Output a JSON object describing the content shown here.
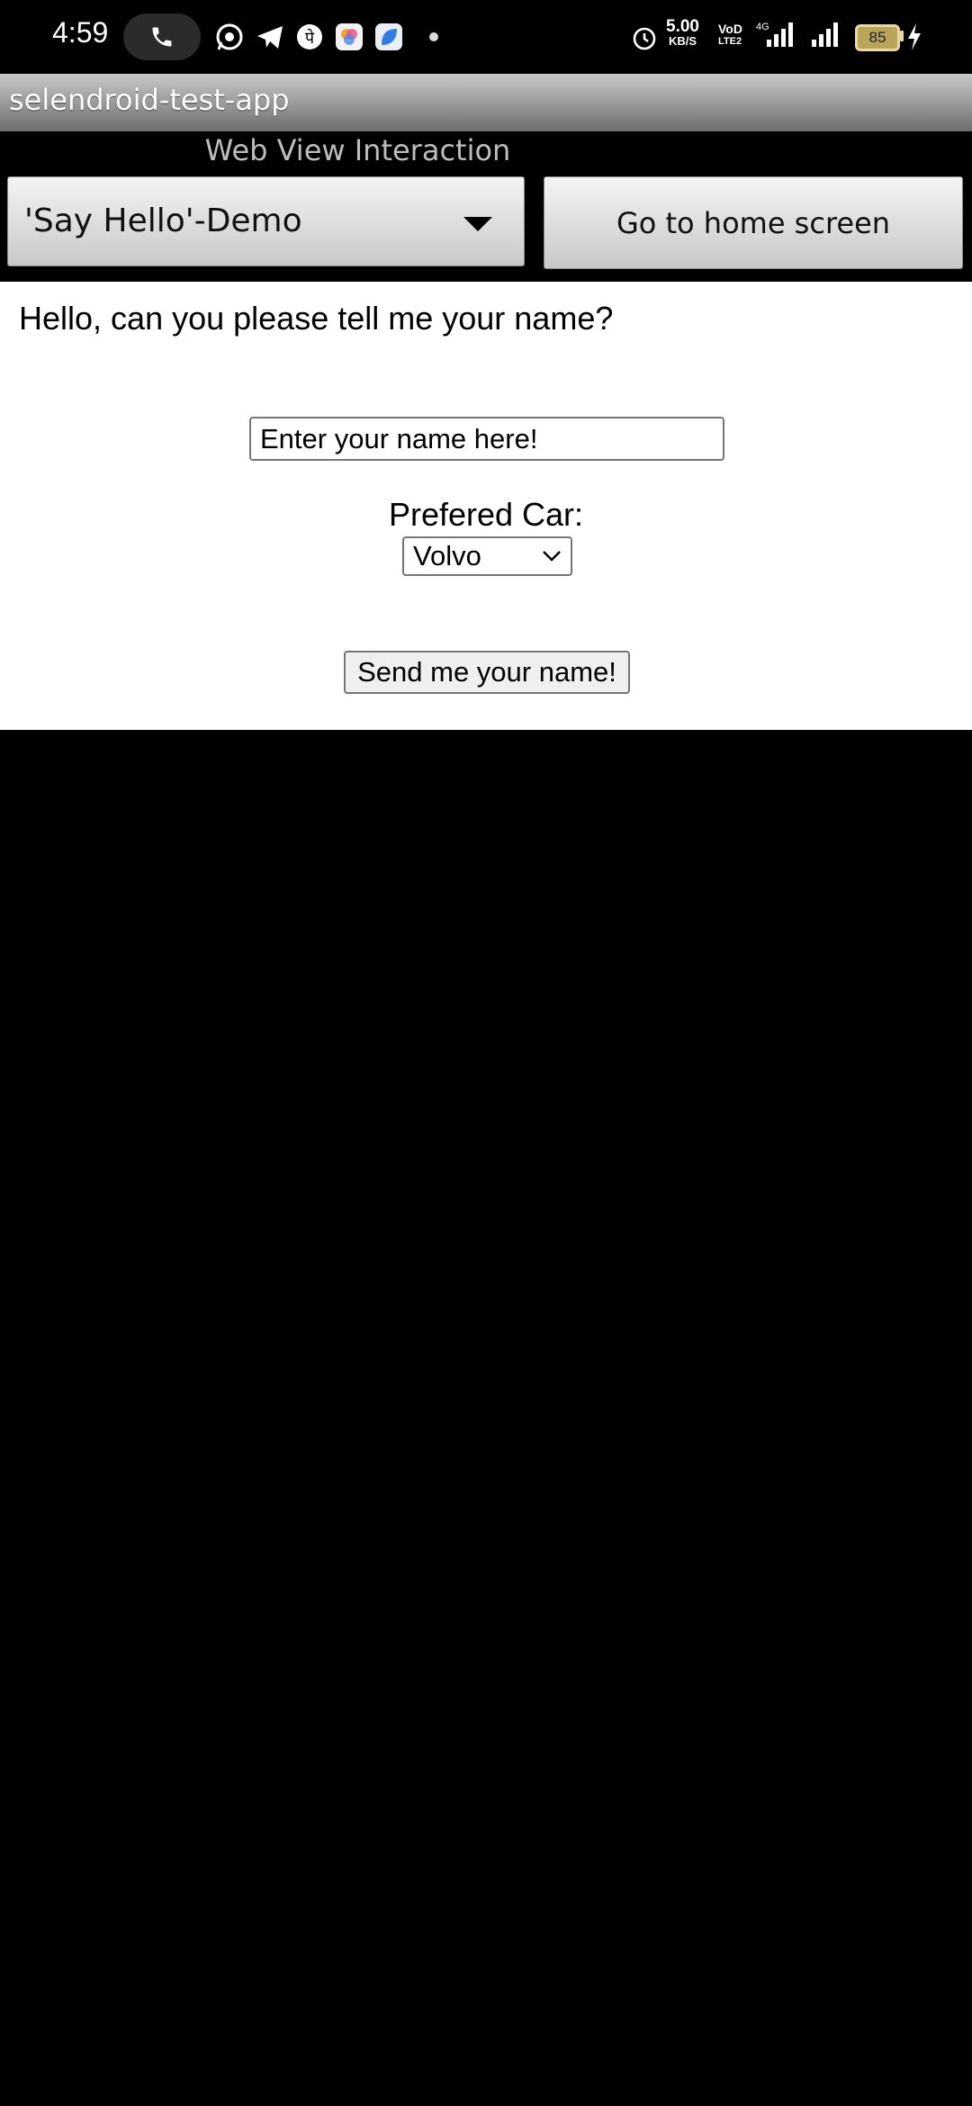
{
  "status_bar": {
    "time": "4:59",
    "net_speed_value": "5.00",
    "net_speed_unit": "KB/S",
    "volte_top": "VoD",
    "volte_bottom": "LTE2",
    "network_type": "4G",
    "battery_level": "85",
    "icons": [
      "phone-icon",
      "whatsapp-icon",
      "telegram-icon",
      "phonepe-icon",
      "photos-icon",
      "blue-app-icon",
      "alarm-icon",
      "signal-icon",
      "charging-icon"
    ]
  },
  "app_bar": {
    "title": "selendroid-test-app"
  },
  "header": {
    "section_label": "Web View Interaction",
    "spinner_value": "'Say Hello'-Demo",
    "home_button_label": "Go to home screen"
  },
  "webview": {
    "question": "Hello, can you please tell me your name?",
    "name_placeholder": "Enter your name here!",
    "car_label": "Prefered Car:",
    "car_selected": "Volvo",
    "send_button_label": "Send me your name!"
  },
  "colors": {
    "background": "#000000",
    "webview_bg": "#ffffff",
    "appbar_top": "#c9c9c9",
    "appbar_bottom": "#6d6d6d",
    "section_label": "#bdbdbd",
    "battery_fill": "#b9a45c"
  }
}
